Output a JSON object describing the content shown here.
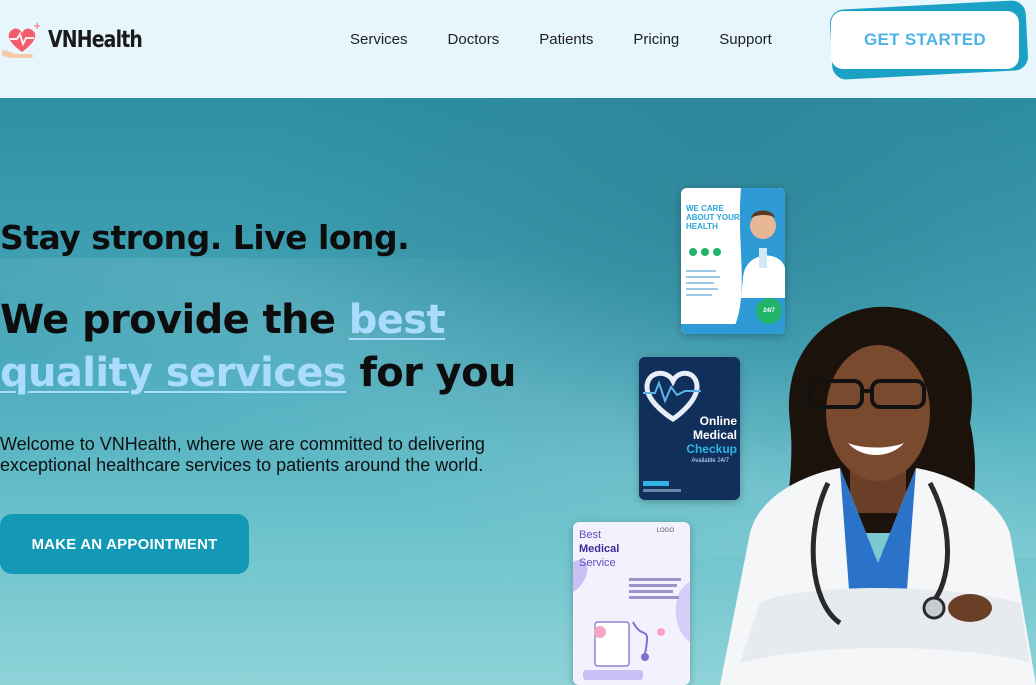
{
  "header": {
    "brand": "VNHealth",
    "nav": [
      "Services",
      "Doctors",
      "Patients",
      "Pricing",
      "Support"
    ],
    "cta_label": "GET STARTED"
  },
  "hero": {
    "tagline": "Stay strong. Live long.",
    "headline_pre": "We provide the ",
    "headline_highlight": "best quality services",
    "headline_post": " for you",
    "intro": "Welcome to VNHealth, where we are committed to delivering exceptional healthcare services to patients around the world.",
    "appointment_label": "MAKE AN APPOINTMENT"
  },
  "flyers": {
    "care": {
      "title": "WE CARE ABOUT YOUR HEALTH",
      "badge": "24/7"
    },
    "checkup": {
      "line1": "Online",
      "line2": "Medical",
      "line3": "Checkup",
      "sub": "Available 24/7"
    },
    "service": {
      "line1": "Best",
      "line2": "Medical",
      "line3": "Service",
      "logo": "LOGO"
    }
  },
  "colors": {
    "accent": "#1399b6",
    "highlight": "#a9dcff",
    "header_bg": "#e6f6fc"
  },
  "icons": {
    "logo": "heart-hand-icon"
  }
}
